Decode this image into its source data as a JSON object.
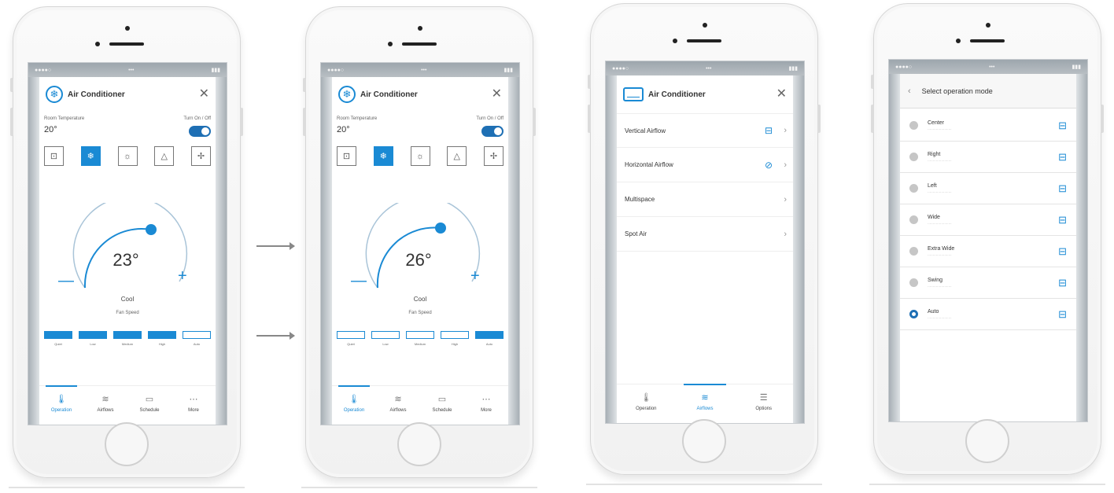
{
  "screens": [
    {
      "title": "Air Conditioner",
      "room_temp_label": "Room Temperature",
      "room_temp": "20°",
      "power_label": "Turn On / Off",
      "target_temp": "23°",
      "mode_name": "Cool",
      "fan_speed_label": "Fan Speed",
      "fan_levels": [
        "Quiet",
        "Low",
        "Medium",
        "High",
        "Auto"
      ],
      "fan_active": [
        true,
        true,
        true,
        true,
        false
      ],
      "tabs": [
        "Operation",
        "Airflows",
        "Schedule",
        "More"
      ],
      "active_tab": 0
    },
    {
      "title": "Air Conditioner",
      "room_temp_label": "Room Temperature",
      "room_temp": "20°",
      "power_label": "Turn On / Off",
      "target_temp": "26°",
      "mode_name": "Cool",
      "fan_speed_label": "Fan Speed",
      "fan_levels": [
        "Quiet",
        "Low",
        "Medium",
        "High",
        "Auto"
      ],
      "fan_active": [
        false,
        false,
        false,
        false,
        true
      ],
      "tabs": [
        "Operation",
        "Airflows",
        "Schedule",
        "More"
      ],
      "active_tab": 0
    },
    {
      "title": "Air Conditioner",
      "menu": [
        "Vertical Airflow",
        "Horizontal Airflow",
        "Multispace",
        "Spot Air"
      ],
      "tabs": [
        "Operation",
        "Airflows",
        "Options"
      ],
      "active_tab": 1
    },
    {
      "title": "Select operation mode",
      "options": [
        {
          "name": "Center",
          "selected": false
        },
        {
          "name": "Right",
          "selected": false
        },
        {
          "name": "Left",
          "selected": false
        },
        {
          "name": "Wide",
          "selected": false
        },
        {
          "name": "Extra Wide",
          "selected": false
        },
        {
          "name": "Swing",
          "selected": false
        },
        {
          "name": "Auto",
          "selected": true
        }
      ]
    }
  ],
  "accent_color": "#1a8ad4",
  "toggle_color": "#1e6fb4"
}
